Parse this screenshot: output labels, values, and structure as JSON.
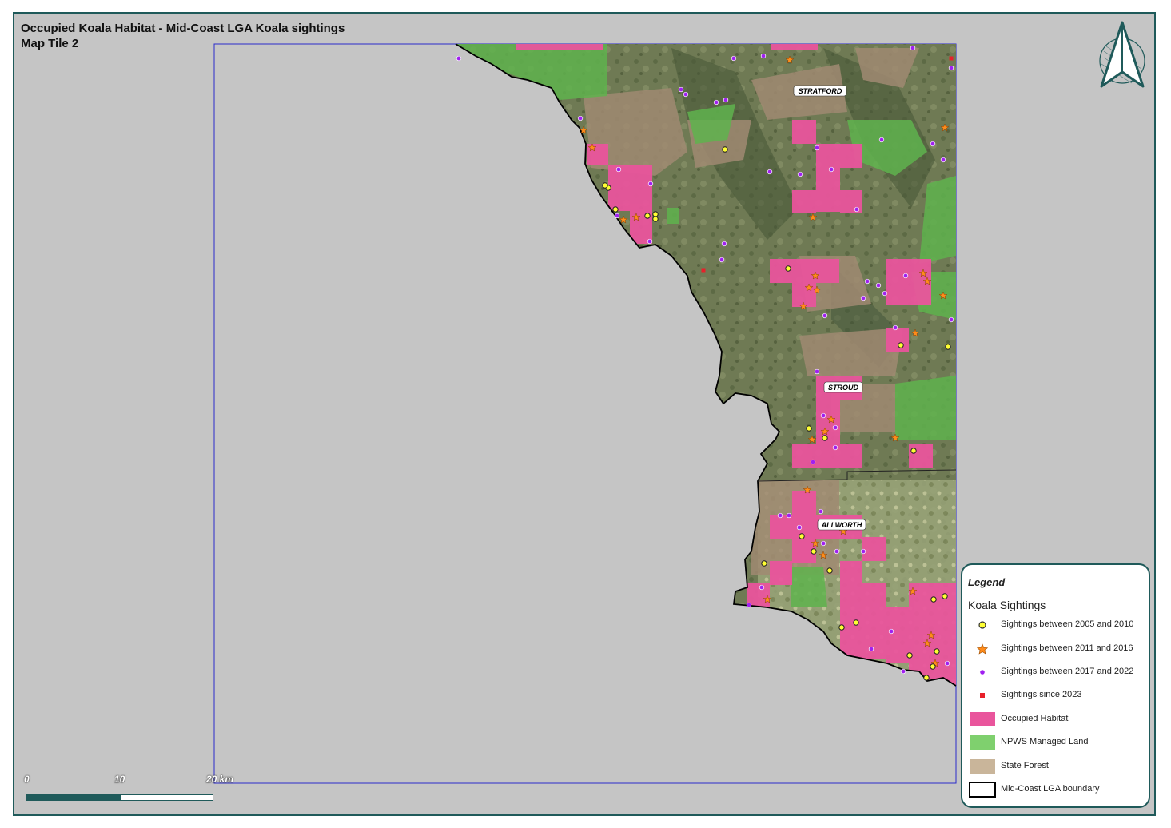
{
  "header": {
    "title": "Occupied Koala Habitat - Mid-Coast LGA Koala sightings",
    "subtitle": "Map Tile 2"
  },
  "places": [
    {
      "name": "STRATFORD"
    },
    {
      "name": "STROUD"
    },
    {
      "name": "ALLWORTH"
    }
  ],
  "scalebar": {
    "labels": [
      "0",
      "10",
      "20 km"
    ],
    "colors": [
      "#1f5a5a",
      "#ffffff"
    ]
  },
  "legend": {
    "title": "Legend",
    "subtitle": "Koala Sightings",
    "items": [
      {
        "label": "Sightings between 2005 and 2010",
        "symbol": "yellow-circle",
        "color": "#ffff33"
      },
      {
        "label": "Sightings between 2011 and 2016",
        "symbol": "orange-star",
        "color": "#ff8c1a"
      },
      {
        "label": "Sightings between 2017 and 2022",
        "symbol": "purple-circle",
        "color": "#a020f0"
      },
      {
        "label": "Sightings since 2023",
        "symbol": "red-square",
        "color": "#e8202a"
      },
      {
        "label": "Occupied Habitat",
        "symbol": "pink-box",
        "color": "#e9559c"
      },
      {
        "label": "NPWS Managed Land",
        "symbol": "green-box",
        "color": "#7fd06e"
      },
      {
        "label": "State Forest",
        "symbol": "tan-box",
        "color": "#c9b59a"
      },
      {
        "label": "Mid-Coast LGA boundary",
        "symbol": "outline-box",
        "color": "#000000"
      }
    ]
  },
  "colors": {
    "frame": "#1f5a5a",
    "background": "#c5c5c5",
    "terrain": "#6f7a54",
    "habitat": "#e9559c",
    "npws": "#5fb34e",
    "forest": "#a08a72"
  }
}
